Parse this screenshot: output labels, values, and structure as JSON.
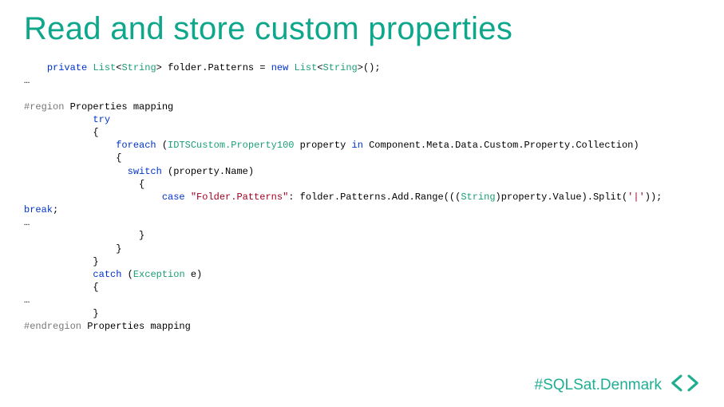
{
  "title": "Read and store custom properties",
  "footer": {
    "hashtag": "#SQLSat.Denmark"
  },
  "code": {
    "line1": {
      "indent": "    ",
      "kw_private": "private",
      "sp1": " ",
      "type_list1": "List",
      "lt1": "<",
      "type_string1": "String",
      "gt1": ">",
      "sp2": " folder.Patterns = ",
      "kw_new": "new",
      "sp3": " ",
      "type_list2": "List",
      "lt2": "<",
      "type_string2": "String",
      "gt2": ">",
      "tail": "();"
    },
    "line2": "…",
    "line3": "",
    "line4": {
      "pp": "#region",
      "rest": " Properties mapping"
    },
    "line5": {
      "indent": "            ",
      "kw": "try"
    },
    "line6": "            {",
    "line7": {
      "indent": "                ",
      "kw_foreach": "foreach",
      "sp1": " (",
      "type_idts": "IDTSCustom.Property100",
      "sp2": " property ",
      "kw_in": "in",
      "rest": " Component.Meta.Data.Custom.Property.Collection)"
    },
    "line8": "                {",
    "line9": {
      "indent": "                  ",
      "kw": "switch",
      "rest": " (property.Name)"
    },
    "line10": "                    {",
    "line11": {
      "indent": "                        ",
      "kw_case": "case",
      "sp1": " ",
      "str": "\"Folder.Patterns\"",
      "mid1": ": folder.Patterns.Add.Range(((",
      "type_string": "String",
      "mid2": ")property.Value).Split(",
      "chr": "'|'",
      "tail": "));"
    },
    "line12": {
      "kw": "break",
      "tail": ";"
    },
    "line13": "…",
    "line14": "                    }",
    "line15": "                }",
    "line16": "            }",
    "line17": {
      "indent": "            ",
      "kw": "catch",
      "sp": " (",
      "type": "Exception",
      "rest": " e)"
    },
    "line18": "            {",
    "line19": "…",
    "line20": "            }",
    "line21": {
      "pp": "#endregion",
      "rest": " Properties mapping"
    }
  }
}
